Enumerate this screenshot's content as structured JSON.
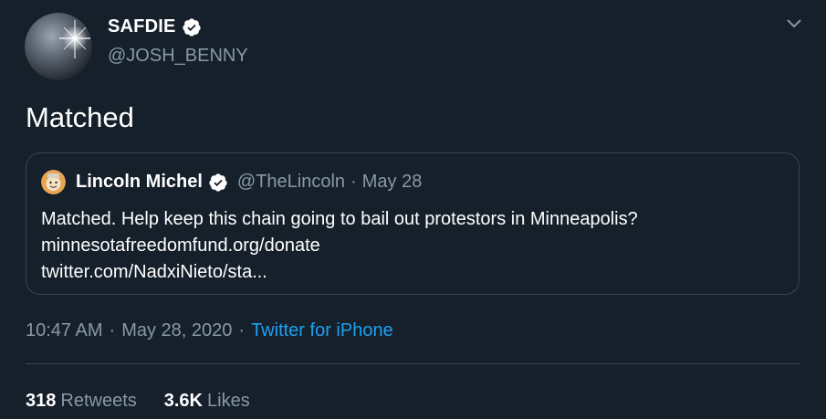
{
  "author": {
    "name": "SAFDIE",
    "handle": "@JOSH_BENNY",
    "verified": true,
    "avatar_icon": "starburst-avatar-icon"
  },
  "tweet": {
    "text": "Matched"
  },
  "quoted_tweet": {
    "name": "Lincoln Michel",
    "handle": "@TheLincoln",
    "separator": "·",
    "date": "May 28",
    "verified": true,
    "avatar_icon": "cartoon-avatar-icon",
    "lines": [
      "Matched. Help keep this chain going to bail out protestors in Minneapolis?",
      "minnesotafreedomfund.org/donate",
      "twitter.com/NadxiNieto/sta..."
    ]
  },
  "meta": {
    "time": "10:47 AM",
    "separator": "·",
    "date": "May 28, 2020",
    "source": "Twitter for iPhone"
  },
  "stats": {
    "retweets_count": "318",
    "retweets_label": "Retweets",
    "likes_count": "3.6K",
    "likes_label": "Likes"
  },
  "colors": {
    "background": "#15202b",
    "primary_text": "#ffffff",
    "secondary_text": "#8899a6",
    "accent": "#1da1f2",
    "border": "#38444d"
  }
}
